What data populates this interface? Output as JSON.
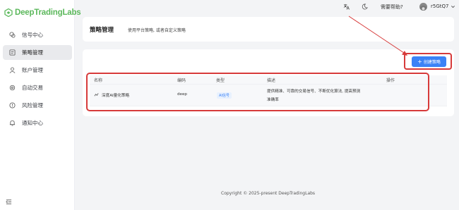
{
  "brand": {
    "name": "DeepTradingLabs",
    "color": "#5cb85c"
  },
  "sidebar": {
    "items": [
      {
        "label": "信号中心",
        "icon": "signal-icon"
      },
      {
        "label": "策略管理",
        "icon": "strategy-icon",
        "active": true
      },
      {
        "label": "账户管理",
        "icon": "user-icon"
      },
      {
        "label": "自动交易",
        "icon": "auto-trade-icon"
      },
      {
        "label": "风险管理",
        "icon": "risk-icon"
      },
      {
        "label": "通知中心",
        "icon": "bell-icon"
      }
    ]
  },
  "topbar": {
    "help": "需要帮助?",
    "username": "r5GtQ7"
  },
  "header": {
    "title": "策略管理",
    "subtitle": "使用平台策略, 或者自定义策略"
  },
  "toolbar": {
    "create_label": "创建策略"
  },
  "table": {
    "columns": [
      "名称",
      "编码",
      "类型",
      "描述",
      "操作"
    ],
    "rows": [
      {
        "name": "深度AI量化策略",
        "code": "deep",
        "type": "AI信号",
        "description_line1": "提供精准、可靠的交易信号、不断优化算法, 提高预测",
        "description_line2": "准确率"
      }
    ]
  },
  "footer": {
    "copyright": "Copyright © 2025-present DeepTradingLabs"
  },
  "colors": {
    "accent": "#3b82f6",
    "annotation": "#d73a3a"
  }
}
